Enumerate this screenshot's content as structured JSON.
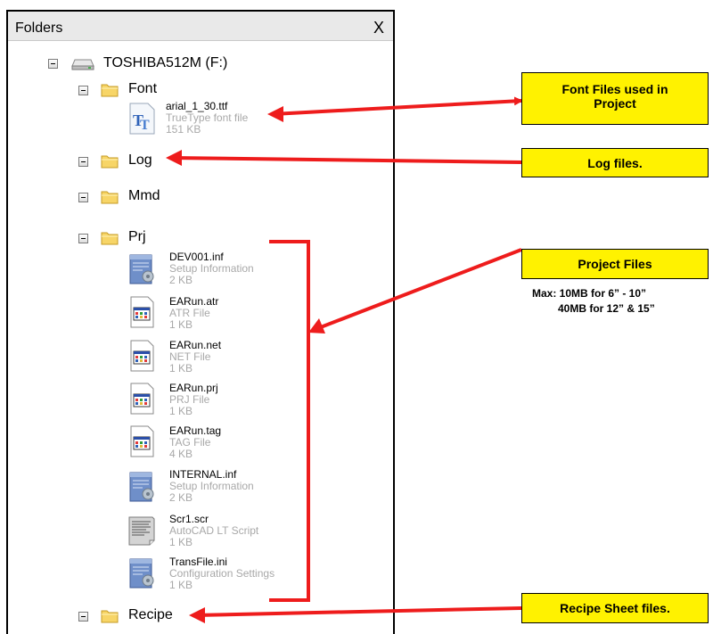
{
  "panel": {
    "title": "Folders",
    "close_label": "X"
  },
  "tree": {
    "drive": {
      "label": "TOSHIBA512M (F:)",
      "icon": "drive-icon"
    },
    "folders": {
      "font": {
        "label": "Font",
        "files": [
          {
            "name": "arial_1_30.ttf",
            "type": "TrueType font file",
            "size": "151 KB",
            "icon": "truetype-font-icon"
          }
        ]
      },
      "log": {
        "label": "Log"
      },
      "mmd": {
        "label": "Mmd"
      },
      "prj": {
        "label": "Prj",
        "files": [
          {
            "name": "DEV001.inf",
            "type": "Setup Information",
            "size": "2 KB",
            "icon": "setup-information-icon"
          },
          {
            "name": "EARun.atr",
            "type": "ATR File",
            "size": "1 KB",
            "icon": "app-file-icon"
          },
          {
            "name": "EARun.net",
            "type": "NET File",
            "size": "1 KB",
            "icon": "app-file-icon"
          },
          {
            "name": "EARun.prj",
            "type": "PRJ File",
            "size": "1 KB",
            "icon": "app-file-icon"
          },
          {
            "name": "EARun.tag",
            "type": "TAG File",
            "size": "4 KB",
            "icon": "app-file-icon"
          },
          {
            "name": "INTERNAL.inf",
            "type": "Setup Information",
            "size": "2 KB",
            "icon": "setup-information-icon"
          },
          {
            "name": "Scr1.scr",
            "type": "AutoCAD LT Script",
            "size": "1 KB",
            "icon": "script-file-icon"
          },
          {
            "name": "TransFile.ini",
            "type": "Configuration Settings",
            "size": "1 KB",
            "icon": "setup-information-icon"
          }
        ]
      },
      "recipe": {
        "label": "Recipe"
      }
    }
  },
  "callouts": {
    "font_files": {
      "line1": "Font Files used in",
      "line2": "Project"
    },
    "log_files": "Log files.",
    "project_files": "Project Files",
    "project_max_line1": "Max: 10MB for 6” - 10”",
    "project_max_line2": "40MB for 12” & 15”",
    "recipe_files": "Recipe Sheet files."
  },
  "colors": {
    "arrow": "#ee1c1c",
    "callout_fill": "#fff200",
    "folder_fill": "#f7d567",
    "secondary_text": "#a8a8a8"
  }
}
